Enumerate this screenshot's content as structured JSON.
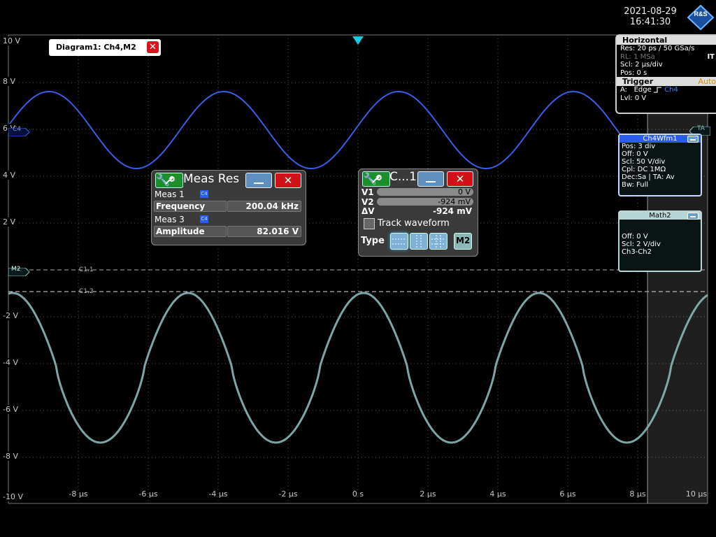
{
  "datetime": {
    "date": "2021-08-29",
    "time": "16:41:30"
  },
  "logo": {
    "text": "R&S"
  },
  "diagram_tab": {
    "title": "Diagram1: Ch4,M2",
    "close": "✕"
  },
  "y_axis_upper": [
    "10 V",
    "8 V",
    "6 V",
    "4 V",
    "2 V"
  ],
  "y_axis_lower": [
    "-2 V",
    "-4 V",
    "-6 V",
    "-8 V",
    "-10 V"
  ],
  "x_axis": [
    "-8 µs",
    "-6 µs",
    "-4 µs",
    "-2 µs",
    "0 s",
    "2 µs",
    "4 µs",
    "6 µs",
    "8 µs",
    "10 µs"
  ],
  "markers": {
    "ch4": "C4",
    "m2": "M2",
    "ta": "TA",
    "cursor1": "C1.1",
    "cursor2": "C1.2"
  },
  "horizontal": {
    "header": "Horizontal",
    "res": "Res: 20 ps / 50 GSa/s",
    "rl": "RL:  1 MSa",
    "rl_mode": "IT",
    "scl": "Scl:  2 µs/div",
    "pos": "Pos: 0 s"
  },
  "trigger": {
    "header": "Trigger",
    "mode": "Auto",
    "a_label": "A:",
    "type": "Edge",
    "slope_icon": "rising-edge-icon",
    "source": "Ch4",
    "lvl": "Lvl:   0 V"
  },
  "ch4wfm": {
    "title": "Ch4Wfm1",
    "rows": [
      "Pos: 3 div",
      "Off:  0 V",
      "Scl:  50 V/div",
      "Cpl:  DC 1MΩ",
      "Dec:Sa | TA: Av",
      "Bw:  Full"
    ],
    "color": "#2a5cf0"
  },
  "math2": {
    "title": "Math2",
    "rows": [
      "Off:  0 V",
      "Scl:  2 V/div",
      "Ch3-Ch2"
    ],
    "color": "#b9d6d6"
  },
  "meas_dialog": {
    "title": "Meas Res",
    "meas1": {
      "label": "Meas 1",
      "badge": "C4",
      "name": "Frequency",
      "value": "200.04 kHz"
    },
    "meas3": {
      "label": "Meas 3",
      "badge": "C4",
      "name": "Amplitude",
      "value": "82.016 V"
    }
  },
  "cursor_dialog": {
    "title": "C...1",
    "v1_label": "V1",
    "v1": "0 V",
    "v2_label": "V2",
    "v2": "-924 mV",
    "dv_label": "ΔV",
    "dv": "-924 mV",
    "track_label": "Track waveform",
    "type_label": "Type",
    "m2_label": "M2"
  },
  "colors": {
    "ch4": "#3a5ee8",
    "math2": "#8ab8b8",
    "grid": "#555555",
    "trigger_marker": "#19c9e0"
  }
}
